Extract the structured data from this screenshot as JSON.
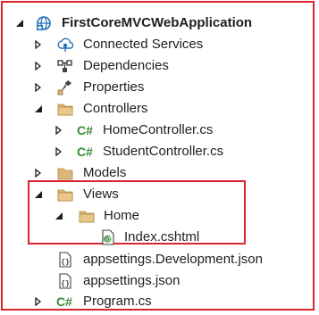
{
  "colors": {
    "frame": "#d9262b",
    "folder": "#dcb67a",
    "folder_dark": "#c79a4e",
    "csharp": "#388a34",
    "arrow": "#1e1e1e"
  },
  "tree": {
    "project": {
      "label": "FirstCoreMVCWebApplication",
      "icon": "web-project-icon"
    },
    "items": [
      {
        "label": "Connected Services",
        "icon": "connected-services-icon"
      },
      {
        "label": "Dependencies",
        "icon": "dependencies-icon"
      },
      {
        "label": "Properties",
        "icon": "properties-icon"
      },
      {
        "label": "Controllers",
        "icon": "folder-icon"
      },
      {
        "label": "HomeController.cs",
        "icon": "csharp-file-icon"
      },
      {
        "label": "StudentController.cs",
        "icon": "csharp-file-icon"
      },
      {
        "label": "Models",
        "icon": "folder-icon"
      },
      {
        "label": "Views",
        "icon": "folder-icon"
      },
      {
        "label": "Home",
        "icon": "folder-icon"
      },
      {
        "label": "Index.cshtml",
        "icon": "razor-file-icon"
      },
      {
        "label": "appsettings.Development.json",
        "icon": "json-file-icon"
      },
      {
        "label": "appsettings.json",
        "icon": "json-file-icon"
      },
      {
        "label": "Program.cs",
        "icon": "csharp-file-icon"
      }
    ]
  }
}
